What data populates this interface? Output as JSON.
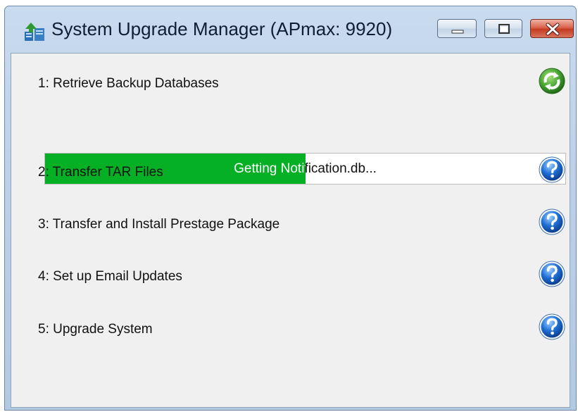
{
  "window": {
    "title": "System Upgrade Manager (APmax: 9920)",
    "app_icon": "server-upgrade-icon"
  },
  "titlebar_buttons": [
    {
      "name": "minimize-button",
      "icon": "minimize-icon"
    },
    {
      "name": "maximize-button",
      "icon": "maximize-icon"
    },
    {
      "name": "close-button",
      "icon": "close-icon"
    }
  ],
  "steps": [
    {
      "label": "1: Retrieve Backup Databases",
      "status_icon": "refresh-icon"
    },
    {
      "label": "2: Transfer TAR Files",
      "status_icon": "help-icon"
    },
    {
      "label": "3: Transfer and Install Prestage Package",
      "status_icon": "help-icon"
    },
    {
      "label": "4: Set up Email Updates",
      "status_icon": "help-icon"
    },
    {
      "label": "5: Upgrade System",
      "status_icon": "help-icon"
    }
  ],
  "progress": {
    "text": "Getting Notification.db...",
    "fraction": 0.5
  },
  "colors": {
    "progress_fill": "#06b025",
    "help_icon": "#1f6fd6",
    "refresh_icon": "#3f9a2e"
  }
}
